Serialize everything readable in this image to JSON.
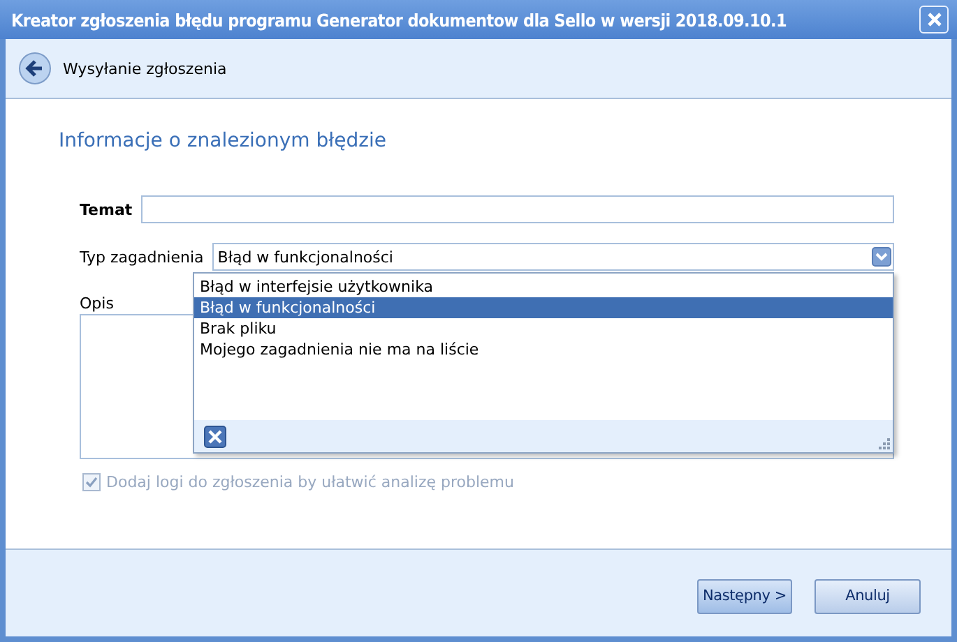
{
  "window": {
    "title": "Kreator zgłoszenia błędu programu Generator dokumentow dla Sello w wersji 2018.09.10.1"
  },
  "header": {
    "step": "Wysyłanie zgłoszenia"
  },
  "section_title": "Informacje o znalezionym błędzie",
  "form": {
    "subject_label": "Temat",
    "type_label": "Typ zagadnienia",
    "type_value": "Błąd w funkcjonalności",
    "description_label": "Opis",
    "options": [
      {
        "label": "Błąd w interfejsie użytkownika",
        "selected": false
      },
      {
        "label": "Błąd w funkcjonalności",
        "selected": true
      },
      {
        "label": "Brak pliku",
        "selected": false
      },
      {
        "label": "Mojego zagadnienia nie ma na liście",
        "selected": false
      }
    ],
    "logs": {
      "label": "Dodaj logi do zgłoszenia by ułatwić analizę problemu",
      "checked": true,
      "disabled": true
    }
  },
  "buttons": [
    {
      "label": "Następny >",
      "kind": "primary"
    },
    {
      "label": "Anuluj",
      "kind": "normal"
    }
  ]
}
